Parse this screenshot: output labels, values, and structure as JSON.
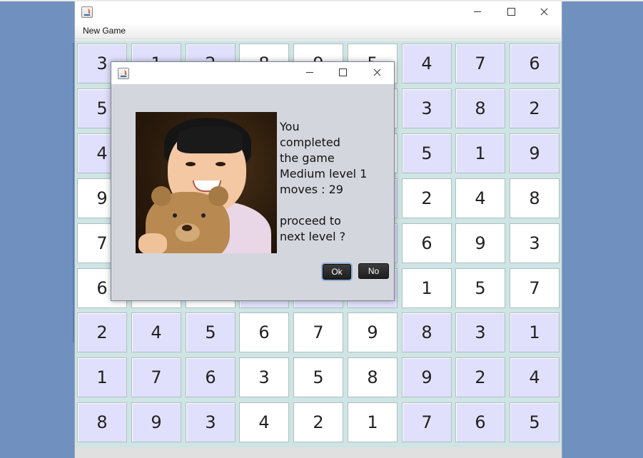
{
  "menu": {
    "new_game": "New Game"
  },
  "board": [
    [
      {
        "v": "3",
        "s": "lav"
      },
      {
        "v": "1",
        "s": "lav"
      },
      {
        "v": "2",
        "s": "lav"
      },
      {
        "v": "8",
        "s": "wht"
      },
      {
        "v": "9",
        "s": "wht"
      },
      {
        "v": "5",
        "s": "wht"
      },
      {
        "v": "4",
        "s": "lav"
      },
      {
        "v": "7",
        "s": "lav"
      },
      {
        "v": "6",
        "s": "lav"
      }
    ],
    [
      {
        "v": "5",
        "s": "lav"
      },
      {
        "v": "",
        "s": "lav"
      },
      {
        "v": "",
        "s": "lav"
      },
      {
        "v": "",
        "s": "wht"
      },
      {
        "v": "",
        "s": "wht"
      },
      {
        "v": "",
        "s": "wht"
      },
      {
        "v": "3",
        "s": "lav"
      },
      {
        "v": "8",
        "s": "lav"
      },
      {
        "v": "2",
        "s": "lav"
      }
    ],
    [
      {
        "v": "4",
        "s": "lav"
      },
      {
        "v": "",
        "s": "lav"
      },
      {
        "v": "",
        "s": "lav"
      },
      {
        "v": "",
        "s": "wht"
      },
      {
        "v": "",
        "s": "wht"
      },
      {
        "v": "",
        "s": "wht"
      },
      {
        "v": "5",
        "s": "lav"
      },
      {
        "v": "1",
        "s": "lav"
      },
      {
        "v": "9",
        "s": "lav"
      }
    ],
    [
      {
        "v": "9",
        "s": "wht"
      },
      {
        "v": "",
        "s": "wht"
      },
      {
        "v": "",
        "s": "wht"
      },
      {
        "v": "",
        "s": "lav"
      },
      {
        "v": "",
        "s": "lav"
      },
      {
        "v": "",
        "s": "lav"
      },
      {
        "v": "2",
        "s": "wht"
      },
      {
        "v": "4",
        "s": "wht"
      },
      {
        "v": "8",
        "s": "wht"
      }
    ],
    [
      {
        "v": "7",
        "s": "wht"
      },
      {
        "v": "",
        "s": "wht"
      },
      {
        "v": "",
        "s": "wht"
      },
      {
        "v": "",
        "s": "lav"
      },
      {
        "v": "",
        "s": "lav"
      },
      {
        "v": "",
        "s": "lav"
      },
      {
        "v": "6",
        "s": "wht"
      },
      {
        "v": "9",
        "s": "wht"
      },
      {
        "v": "3",
        "s": "wht"
      }
    ],
    [
      {
        "v": "6",
        "s": "wht"
      },
      {
        "v": "",
        "s": "wht"
      },
      {
        "v": "",
        "s": "wht"
      },
      {
        "v": "",
        "s": "lav"
      },
      {
        "v": "",
        "s": "lav"
      },
      {
        "v": "",
        "s": "lav"
      },
      {
        "v": "1",
        "s": "wht"
      },
      {
        "v": "5",
        "s": "wht"
      },
      {
        "v": "7",
        "s": "wht"
      }
    ],
    [
      {
        "v": "2",
        "s": "lav"
      },
      {
        "v": "4",
        "s": "lav"
      },
      {
        "v": "5",
        "s": "lav"
      },
      {
        "v": "6",
        "s": "wht"
      },
      {
        "v": "7",
        "s": "wht"
      },
      {
        "v": "9",
        "s": "wht"
      },
      {
        "v": "8",
        "s": "lav"
      },
      {
        "v": "3",
        "s": "lav"
      },
      {
        "v": "1",
        "s": "lav"
      }
    ],
    [
      {
        "v": "1",
        "s": "lav"
      },
      {
        "v": "7",
        "s": "lav"
      },
      {
        "v": "6",
        "s": "lav"
      },
      {
        "v": "3",
        "s": "wht"
      },
      {
        "v": "5",
        "s": "wht"
      },
      {
        "v": "8",
        "s": "wht"
      },
      {
        "v": "9",
        "s": "lav"
      },
      {
        "v": "2",
        "s": "lav"
      },
      {
        "v": "4",
        "s": "lav"
      }
    ],
    [
      {
        "v": "8",
        "s": "lav"
      },
      {
        "v": "9",
        "s": "lav"
      },
      {
        "v": "3",
        "s": "lav"
      },
      {
        "v": "4",
        "s": "wht"
      },
      {
        "v": "2",
        "s": "wht"
      },
      {
        "v": "1",
        "s": "wht"
      },
      {
        "v": "7",
        "s": "lav"
      },
      {
        "v": "6",
        "s": "lav"
      },
      {
        "v": "5",
        "s": "lav"
      }
    ]
  ],
  "dialog": {
    "message_lines": [
      "You",
      "completed",
      "the game",
      "Medium level 1",
      "moves : 29",
      "",
      "proceed to",
      "next level ?"
    ],
    "ok_label": "Ok",
    "no_label": "No"
  },
  "colors": {
    "lavender_cell": "#e1e0fc",
    "white_cell": "#ffffff",
    "board_bg": "#cfe4e4",
    "desktop": "#7090c0"
  },
  "icons": [
    "java-app-icon",
    "minimize-icon",
    "maximize-icon",
    "close-icon"
  ]
}
